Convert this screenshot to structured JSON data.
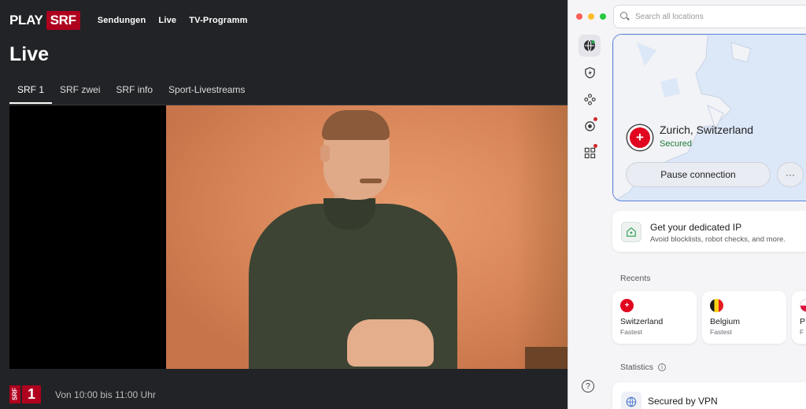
{
  "srf": {
    "logo_play": "PLAY",
    "logo_srf": "SRF",
    "nav": [
      "Sendungen",
      "Live",
      "TV-Programm"
    ],
    "page_title": "Live",
    "channel_tabs": [
      "SRF 1",
      "SRF zwei",
      "SRF info",
      "Sport-Livestreams"
    ],
    "active_tab": "SRF 1",
    "channel_logo_mark": "SRF",
    "channel_logo_num": "1",
    "schedule": "Von 10:00 bis 11:00 Uhr",
    "brand_color": "#af001e"
  },
  "vpn": {
    "search_placeholder": "Search all locations",
    "rail_icons": [
      "globe-icon",
      "shield-bolt-icon",
      "network-icon",
      "eye-icon",
      "apps-icon"
    ],
    "location": "Zurich, Switzerland",
    "status": "Secured",
    "flag_symbol": "+",
    "pause_label": "Pause connection",
    "more_label": "···",
    "ip_title": "Get your dedicated IP",
    "ip_subtitle": "Avoid blocklists, robot checks, and more.",
    "recents_label": "Recents",
    "recents": [
      {
        "name": "Switzerland",
        "sub": "Fastest",
        "flag": "ch"
      },
      {
        "name": "Belgium",
        "sub": "Fastest",
        "flag": "be"
      },
      {
        "name": "P",
        "sub": "F",
        "flag": "pl"
      }
    ],
    "statistics_label": "Statistics",
    "secured_label": "Secured by VPN",
    "help_label": "?",
    "accent_color": "#5b82d8",
    "status_color": "#207a3c"
  }
}
